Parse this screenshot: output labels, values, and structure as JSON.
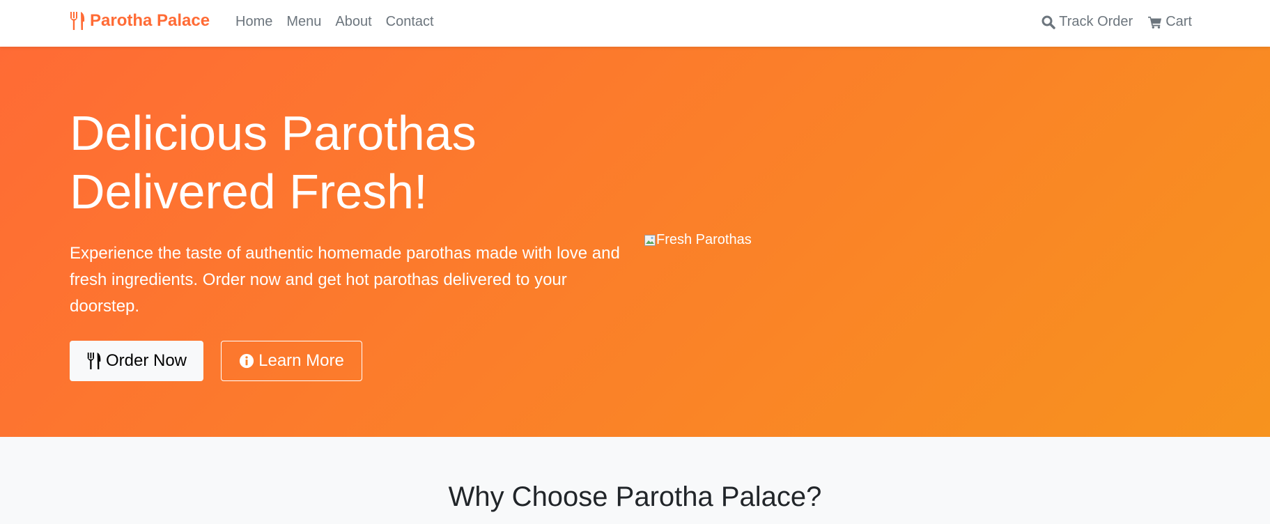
{
  "navbar": {
    "brand": "Parotha Palace",
    "links": [
      "Home",
      "Menu",
      "About",
      "Contact"
    ],
    "track_order": "Track Order",
    "cart": "Cart"
  },
  "hero": {
    "title_line1": "Delicious Parothas",
    "title_line2": "Delivered Fresh!",
    "description": "Experience the taste of authentic homemade parothas made with love and fresh ingredients. Order now and get hot parothas delivered to your doorstep.",
    "order_button": "Order Now",
    "learn_button": "Learn More",
    "image_alt": "Fresh Parothas"
  },
  "features": {
    "title": "Why Choose Parotha Palace?"
  },
  "colors": {
    "brand": "#ff6b35",
    "gradient_start": "#ff6b35",
    "gradient_end": "#f7931e"
  },
  "icons": {
    "brand": "utensils-icon",
    "track": "search-icon",
    "cart": "cart-icon",
    "order": "utensils-icon",
    "learn": "info-circle-icon"
  }
}
